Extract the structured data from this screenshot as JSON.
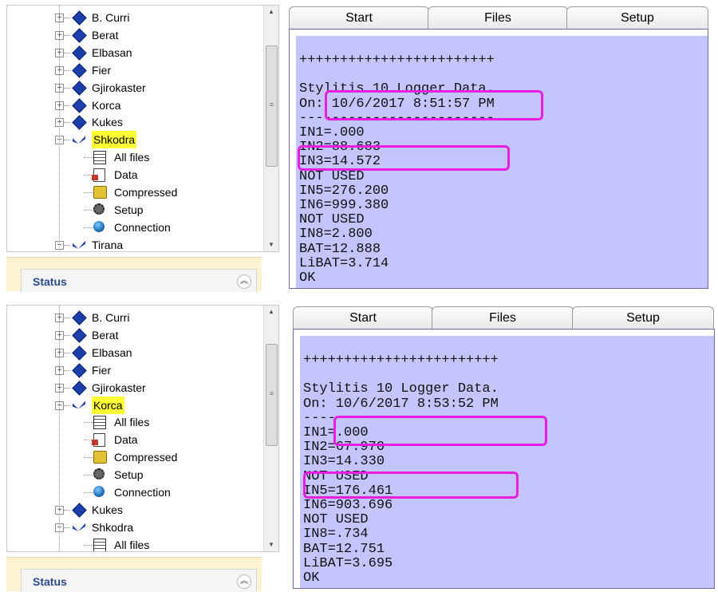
{
  "panels": [
    {
      "tree": {
        "items": [
          {
            "label": "B. Curri",
            "icon": "folder-diamond-icon",
            "expander": "+"
          },
          {
            "label": "Berat",
            "icon": "folder-diamond-icon",
            "expander": "+"
          },
          {
            "label": "Elbasan",
            "icon": "folder-diamond-icon",
            "expander": "+"
          },
          {
            "label": "Fier",
            "icon": "folder-diamond-icon",
            "expander": "+"
          },
          {
            "label": "Gjirokaster",
            "icon": "folder-diamond-icon",
            "expander": "+"
          },
          {
            "label": "Korca",
            "icon": "folder-diamond-icon",
            "expander": "+"
          },
          {
            "label": "Kukes",
            "icon": "folder-diamond-icon",
            "expander": "+"
          },
          {
            "label": "Shkodra",
            "icon": "folder-open-icon",
            "expander": "−",
            "selected": true
          },
          {
            "label": "All files",
            "icon": "all-files-icon",
            "child": true
          },
          {
            "label": "Data",
            "icon": "data-icon",
            "child": true
          },
          {
            "label": "Compressed",
            "icon": "compressed-icon",
            "child": true
          },
          {
            "label": "Setup",
            "icon": "setup-icon",
            "child": true
          },
          {
            "label": "Connection",
            "icon": "connection-icon",
            "child": true
          },
          {
            "label": "Tirana",
            "icon": "folder-open-icon",
            "expander": "−"
          }
        ]
      },
      "status_title": "Status",
      "tabs": [
        "Start",
        "Files",
        "Setup"
      ],
      "console_lines": [
        "++++++++++++++++++++++++",
        "",
        "Stylitis 10 Logger Data.",
        "On: 10/6/2017 8:51:57 PM",
        "------------------------",
        "IN1=.000",
        "IN2=88.683",
        "IN3=14.572",
        "NOT USED",
        "IN5=276.200",
        "IN6=999.380",
        "NOT USED",
        "IN8=2.800",
        "BAT=12.888",
        "LiBAT=3.714",
        "OK"
      ]
    },
    {
      "tree": {
        "items": [
          {
            "label": "B. Curri",
            "icon": "folder-diamond-icon",
            "expander": "+"
          },
          {
            "label": "Berat",
            "icon": "folder-diamond-icon",
            "expander": "+"
          },
          {
            "label": "Elbasan",
            "icon": "folder-diamond-icon",
            "expander": "+"
          },
          {
            "label": "Fier",
            "icon": "folder-diamond-icon",
            "expander": "+"
          },
          {
            "label": "Gjirokaster",
            "icon": "folder-diamond-icon",
            "expander": "+"
          },
          {
            "label": "Korca",
            "icon": "folder-open-icon",
            "expander": "−",
            "selected": true
          },
          {
            "label": "All files",
            "icon": "all-files-icon",
            "child": true
          },
          {
            "label": "Data",
            "icon": "data-icon",
            "child": true
          },
          {
            "label": "Compressed",
            "icon": "compressed-icon",
            "child": true
          },
          {
            "label": "Setup",
            "icon": "setup-icon",
            "child": true
          },
          {
            "label": "Connection",
            "icon": "connection-icon",
            "child": true
          },
          {
            "label": "Kukes",
            "icon": "folder-diamond-icon",
            "expander": "+"
          },
          {
            "label": "Shkodra",
            "icon": "folder-open-icon",
            "expander": "−"
          },
          {
            "label": "All files",
            "icon": "all-files-icon",
            "child": true
          }
        ]
      },
      "status_title": "Status",
      "tabs": [
        "Start",
        "Files",
        "Setup"
      ],
      "console_lines": [
        "++++++++++++++++++++++++",
        "",
        "Stylitis 10 Logger Data.",
        "On: 10/6/2017 8:53:52 PM",
        "----",
        "IN1=.000",
        "IN2=67.970",
        "IN3=14.330",
        "NOT USED",
        "IN5=176.461",
        "IN6=903.696",
        "NOT USED",
        "IN8=.734",
        "BAT=12.751",
        "LiBAT=3.695",
        "OK"
      ]
    }
  ],
  "colors": {
    "highlight_box": "#e81ee0",
    "console_bg": "#c4c4ff",
    "selected_bg": "#ffff33",
    "status_title": "#2a4b8d"
  }
}
